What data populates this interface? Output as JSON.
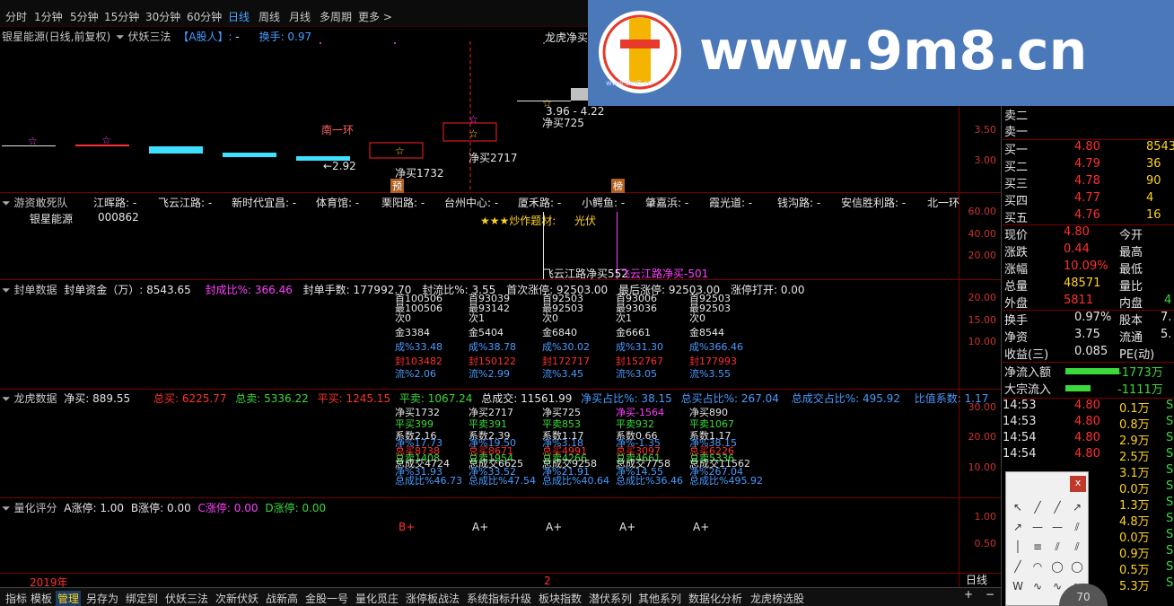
{
  "top_bar": {
    "items": [
      "分时",
      "1分钟",
      "5分钟",
      "15分钟",
      "30分钟",
      "60分钟",
      "日线",
      "周线",
      "月线",
      "多周期",
      "更多 >"
    ],
    "active_index": 6
  },
  "main_chart": {
    "title": "银星能源(日线,前复权)",
    "indicator": "伏妖三法",
    "tag": "【A股人】:",
    "tag_dash": "-",
    "turnover": "换手: 0.97",
    "lhb_header": "龙虎净买",
    "annotation_ring": "南一环",
    "low_label": "←2.92",
    "range_label": "3.96 - 4.22",
    "net_buy": [
      "净买1732",
      "净买2717",
      "净买725"
    ],
    "marker_yu": "预",
    "marker_bang": "榜",
    "star": "☆",
    "y_axis": [
      "3.50",
      "3.00"
    ]
  },
  "pane_youzi": {
    "title": "游资敢死队",
    "stock_name": "银星能源",
    "stock_code": "000862",
    "routes": [
      "江晖路: -",
      "飞云江路: -",
      "新时代宜昌: -",
      "体育馆: -",
      "栗阳路: -",
      "台州中心: -",
      "厦禾路: -",
      "小鳄鱼: -",
      "肇嘉浜: -",
      "霞光道: -",
      "钱沟路: -",
      "安信胜利路: -",
      "北一环"
    ],
    "theme_label": "★★★炒作题材:",
    "theme_value": "光伏",
    "feiyun_a": "飞云江路净买552",
    "feiyun_b": "飞云江路净买-501",
    "y_axis": [
      "60.00",
      "40.00",
      "20.00"
    ]
  },
  "pane_fengdan": {
    "title": "封单数据",
    "amount": "封单资金（万）: 8543.65",
    "ratio": "封成比%: 366.46",
    "hands": "封单手数: 177992.70",
    "flow": "封流比%: 3.55",
    "first": "首次涨停: 92503.00",
    "last": "最后涨停: 92503.00",
    "open": "涨停打开: 0.00",
    "y_axis": [
      "20.00",
      "15.00",
      "10.00"
    ],
    "columns": [
      {
        "t1": "首100506",
        "t2": "最100506",
        "t3": "次0",
        "jin": "金3384",
        "cheng": "成%33.48",
        "feng": "封103482",
        "liu": "流%2.06"
      },
      {
        "t1": "首93039",
        "t2": "最93142",
        "t3": "次1",
        "jin": "金5404",
        "cheng": "成%38.78",
        "feng": "封150122",
        "liu": "流%2.99"
      },
      {
        "t1": "首92503",
        "t2": "最92503",
        "t3": "次0",
        "jin": "金6840",
        "cheng": "成%30.02",
        "feng": "封172717",
        "liu": "流%3.45"
      },
      {
        "t1": "首93006",
        "t2": "最93036",
        "t3": "次1",
        "jin": "金6661",
        "cheng": "成%31.30",
        "feng": "封152767",
        "liu": "流%3.05"
      },
      {
        "t1": "首92503",
        "t2": "最92503",
        "t3": "次0",
        "jin": "金8544",
        "cheng": "成%366.46",
        "feng": "封177993",
        "liu": "流%3.55"
      }
    ]
  },
  "pane_longhu": {
    "title": "龙虎数据",
    "net": "净买: 889.55",
    "total_buy": "总买: 6225.77",
    "total_sell": "总卖: 5336.22",
    "avg_buy": "平买: 1245.15",
    "avg_sell": "平卖: 1067.24",
    "total_vol": "总成交: 11561.99",
    "net_pct": "净买占比%: 38.15",
    "buy_pct": "总买占比%: 267.04",
    "vol_pct": "总成交占比%: 495.92",
    "ratio": "比值系数: 1.17",
    "y_axis": [
      "30.00",
      "20.00",
      "10.00"
    ],
    "columns": [
      {
        "net": "净买1732",
        "a": "平买399",
        "b": "系数2.16",
        "c": "净%17.73",
        "d": "总买8738",
        "e": "总卖1408",
        "f": "总成交4724",
        "g": "净%31.93",
        "h": "总成比%46.73"
      },
      {
        "net": "净买2717",
        "a": "平卖391",
        "b": "系数2.39",
        "c": "净%19.50",
        "d": "总买8671",
        "e": "总卖1954",
        "f": "总成交6625",
        "g": "净%33.52",
        "h": "总成比%47.54"
      },
      {
        "net": "净买725",
        "a": "平卖853",
        "b": "系数1.17",
        "c": "净%3.18",
        "d": "总买4991",
        "e": "总卖4266",
        "f": "总成交9258",
        "g": "净%21.91",
        "h": "总成比%40.64"
      },
      {
        "net": "净买-1564",
        "a": "平卖932",
        "b": "系数0.66",
        "c": "净%-1.35",
        "d": "总买3097",
        "e": "总卖4661",
        "f": "总成交7758",
        "g": "净%14.55",
        "h": "总成比%36.46"
      },
      {
        "net": "净买890",
        "a": "平卖1067",
        "b": "系数1.17",
        "c": "净%38.15",
        "d": "总买6226",
        "e": "总卖5336",
        "f": "总成交11562",
        "g": "净%267.04",
        "h": "总成比%495.92"
      }
    ]
  },
  "pane_lianghua": {
    "title": "量化评分",
    "a": "A涨停: 1.00",
    "b": "B涨停: 0.00",
    "c": "C涨停: 0.00",
    "d": "D涨停: 0.00",
    "grades": [
      "B+",
      "A+",
      "A+",
      "A+",
      "A+"
    ],
    "y_axis": [
      "1.00",
      "0.50"
    ]
  },
  "time_axis": {
    "year": "2019年",
    "month": "2"
  },
  "bottom_bar": {
    "items": [
      "指标",
      "模板",
      "管理",
      "另存为",
      "绑定到",
      "伏妖三法",
      "次新伏妖",
      "战新高",
      "金股一号",
      "量化觅庄",
      "涨停板战法",
      "系统指标升级",
      "板块指数",
      "潜伏系列",
      "其他系列",
      "数据化分析",
      "龙虎榜选股"
    ],
    "active_index": 2
  },
  "right_panel": {
    "sell_rows": [
      {
        "label": "卖二"
      },
      {
        "label": "卖一"
      }
    ],
    "buy_rows": [
      {
        "label": "买一",
        "price": "4.80",
        "vol": "8543"
      },
      {
        "label": "买二",
        "price": "4.79",
        "vol": "36"
      },
      {
        "label": "买三",
        "price": "4.78",
        "vol": "90"
      },
      {
        "label": "买四",
        "price": "4.77",
        "vol": "4"
      },
      {
        "label": "买五",
        "price": "4.76",
        "vol": "16"
      }
    ],
    "quote": [
      {
        "l": "现价",
        "v": "4.80",
        "l2": "今开"
      },
      {
        "l": "涨跌",
        "v": "0.44",
        "l2": "最高"
      },
      {
        "l": "涨幅",
        "v": "10.09%",
        "l2": "最低"
      },
      {
        "l": "总量",
        "v": "48571",
        "l2": "量比"
      },
      {
        "l": "外盘",
        "v": "5811",
        "l2": "内盘",
        "v2": "4"
      }
    ],
    "stats": [
      {
        "l": "换手",
        "v": "0.97%",
        "l2": "股本",
        "v2": "7."
      },
      {
        "l": "净资",
        "v": "3.75",
        "l2": "流通",
        "v2": "5."
      },
      {
        "l": "收益(三)",
        "v": "0.085",
        "l2": "PE(动)"
      }
    ],
    "flow": [
      {
        "l": "净流入额",
        "v": "-1773万"
      },
      {
        "l": "大宗流入",
        "v": "-1111万"
      }
    ],
    "ticks": [
      {
        "t": "14:53",
        "p": "4.80",
        "v": "0.1万",
        "s": "S"
      },
      {
        "t": "14:53",
        "p": "4.80",
        "v": "0.8万",
        "s": "S"
      },
      {
        "t": "14:54",
        "p": "4.80",
        "v": "2.9万",
        "s": "S"
      },
      {
        "t": "14:54",
        "p": "4.80",
        "v": "2.5万",
        "s": "S"
      },
      {
        "v": "3.1万",
        "s": "S"
      },
      {
        "v": "0.0万",
        "s": "S"
      },
      {
        "v": "1.3万",
        "s": "S"
      },
      {
        "v": "4.8万",
        "s": "S"
      },
      {
        "v": "0.0万",
        "s": "S"
      },
      {
        "v": "0.9万",
        "s": "S"
      },
      {
        "v": "0.5万",
        "s": "S"
      },
      {
        "v": "5.3万",
        "s": "S"
      }
    ],
    "period_label": "日线",
    "plus": "+",
    "minus": "−"
  },
  "watermark": {
    "text": "www.9m8.cn",
    "sub": "www.9m8.cn"
  },
  "tool_panel": {
    "close": "x",
    "badge": "70"
  },
  "colors": {
    "bg": "#000000",
    "grid": "#7a0000",
    "up": "#ff3030",
    "down": "#3cd93c",
    "cyan": "#3fe0ff",
    "watermark": "#4a78b8"
  }
}
